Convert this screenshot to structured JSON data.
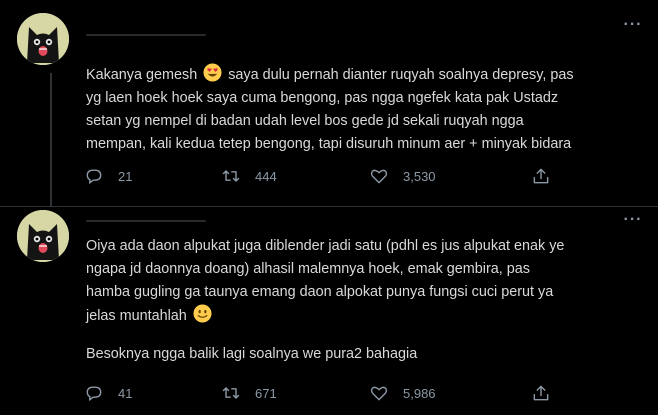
{
  "tweets": [
    {
      "text_lines": [
        "Kakanya gemesh ",
        " saya dulu pernah dianter ruqyah soalnya depresy, pas",
        "yg laen hoek hoek saya cuma bengong, pas ngga ngefek kata pak Ustadz",
        "setan yg nempel di badan udah level bos gede jd sekali ruqyah ngga",
        "mempan, kali kedua tetep bengong, tapi disuruh minum aer + minyak bidara"
      ],
      "emoji": "heart-eyes-emoji",
      "replies": "21",
      "retweets": "444",
      "likes": "3,530"
    },
    {
      "text_lines": [
        "Oiya ada daon alpukat juga diblender jadi satu (pdhl es jus alpukat enak ye",
        "ngapa jd daonnya doang) alhasil malemnya hoek, emak gembira, pas",
        "hamba gugling ga taunya emang daon alpokat punya fungsi cuci perut ya",
        "jelas muntahlah "
      ],
      "text_extra": "Besoknya ngga balik lagi soalnya we pura2 bahagia",
      "emoji": "slight-smile-emoji",
      "replies": "41",
      "retweets": "671",
      "likes": "5,986"
    }
  ],
  "more_label": "···",
  "colors": {
    "background": "#000000",
    "text": "#d9d9d9",
    "secondary": "#8b98a5",
    "line": "#2f3336"
  }
}
